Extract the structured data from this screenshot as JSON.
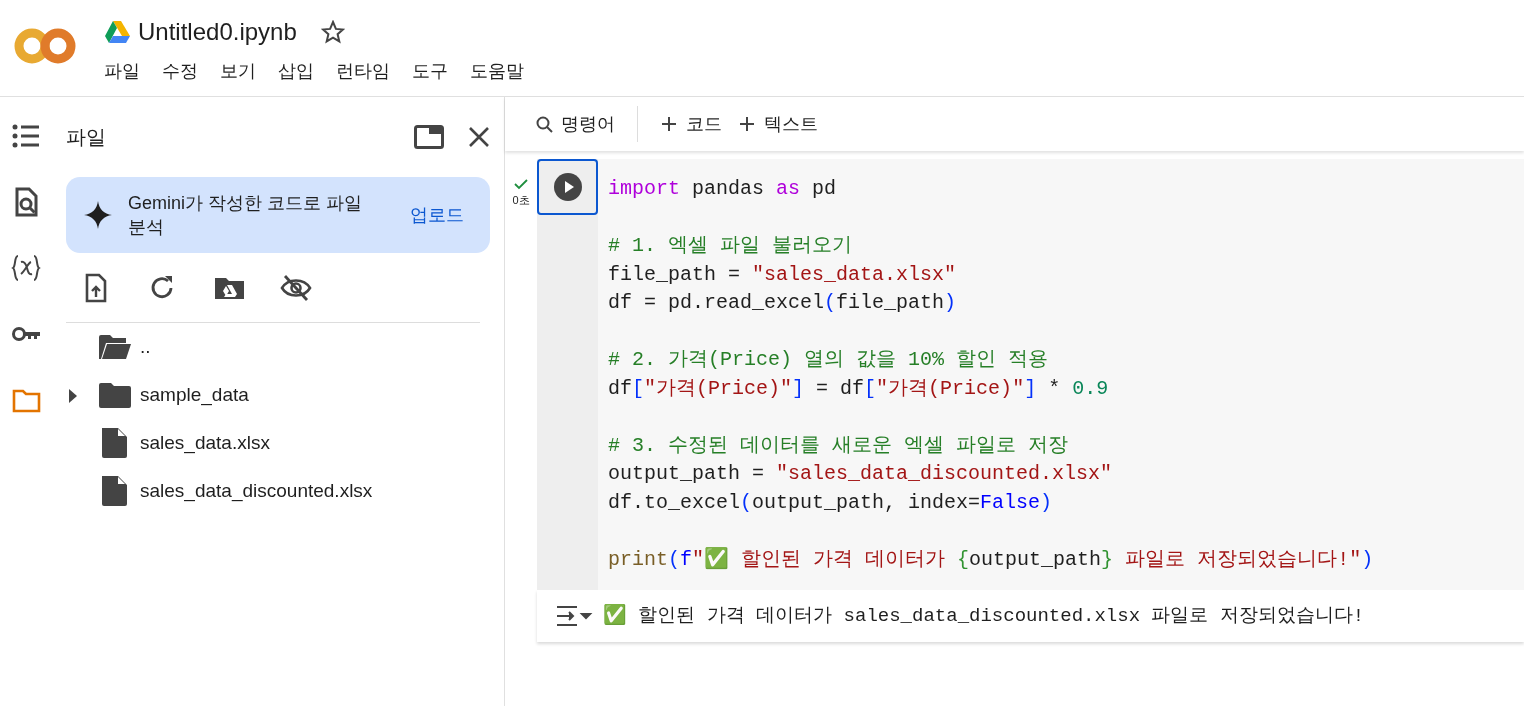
{
  "header": {
    "title": "Untitled0.ipynb",
    "starred": false,
    "menu": [
      "파일",
      "수정",
      "보기",
      "삽입",
      "런타임",
      "도구",
      "도움말"
    ]
  },
  "sidebar": {
    "rail": [
      {
        "kind": "toc",
        "selected": false
      },
      {
        "kind": "find",
        "selected": false
      },
      {
        "kind": "variables",
        "selected": false
      },
      {
        "kind": "secrets",
        "selected": false
      },
      {
        "kind": "files",
        "selected": true
      }
    ],
    "panel": {
      "title": "파일",
      "banner": {
        "text": "Gemini가 작성한 코드로 파일 분석",
        "action": "업로드"
      },
      "tools": [
        {
          "kind": "upload"
        },
        {
          "kind": "refresh"
        },
        {
          "kind": "drive"
        },
        {
          "kind": "hidden"
        }
      ],
      "tree": [
        {
          "kind": "parent",
          "name": ".."
        },
        {
          "kind": "folder",
          "name": "sample_data",
          "expanded": false
        },
        {
          "kind": "file",
          "name": "sales_data.xlsx"
        },
        {
          "kind": "file",
          "name": "sales_data_discounted.xlsx"
        }
      ]
    }
  },
  "toolbar": [
    {
      "kind": "search",
      "label": "명령어"
    },
    {
      "kind": "add",
      "label": "코드"
    },
    {
      "kind": "add",
      "label": "텍스트"
    }
  ],
  "cell": {
    "succeeded": true,
    "time": "0초",
    "code": [
      [
        [
          {
            "kind": "kw",
            "text": "import"
          },
          {
            "kind": "plain",
            "text": " pandas "
          },
          {
            "kind": "kw",
            "text": "as"
          },
          {
            "kind": "plain",
            "text": " pd"
          }
        ]
      ],
      [
        [
          {
            "kind": "comment",
            "text": "# 1. 엑셀 파일 불러오기"
          }
        ],
        [
          {
            "kind": "plain",
            "text": "file_path = "
          },
          {
            "kind": "str",
            "text": "\"sales_data.xlsx\""
          }
        ],
        [
          {
            "kind": "plain",
            "text": "df = pd.read_excel"
          },
          {
            "kind": "bracket",
            "text": "("
          },
          {
            "kind": "plain",
            "text": "file_path"
          },
          {
            "kind": "bracket",
            "text": ")"
          }
        ]
      ],
      [
        [
          {
            "kind": "comment",
            "text": "# 2. 가격(Price) 열의 값을 10% 할인 적용"
          }
        ],
        [
          {
            "kind": "plain",
            "text": "df"
          },
          {
            "kind": "bracket",
            "text": "["
          },
          {
            "kind": "str",
            "text": "\"가격(Price)\""
          },
          {
            "kind": "bracket",
            "text": "]"
          },
          {
            "kind": "plain",
            "text": " = df"
          },
          {
            "kind": "bracket",
            "text": "["
          },
          {
            "kind": "str",
            "text": "\"가격(Price)\""
          },
          {
            "kind": "bracket",
            "text": "]"
          },
          {
            "kind": "plain",
            "text": " * "
          },
          {
            "kind": "num",
            "text": "0.9"
          }
        ]
      ],
      [
        [
          {
            "kind": "comment",
            "text": "# 3. 수정된 데이터를 새로운 엑셀 파일로 저장"
          }
        ],
        [
          {
            "kind": "plain",
            "text": "output_path = "
          },
          {
            "kind": "str",
            "text": "\"sales_data_discounted.xlsx\""
          }
        ],
        [
          {
            "kind": "plain",
            "text": "df.to_excel"
          },
          {
            "kind": "bracket",
            "text": "("
          },
          {
            "kind": "plain",
            "text": "output_path, index="
          },
          {
            "kind": "const",
            "text": "False"
          },
          {
            "kind": "bracket",
            "text": ")"
          }
        ]
      ],
      [
        [
          {
            "kind": "builtin",
            "text": "print"
          },
          {
            "kind": "bracket",
            "text": "("
          },
          {
            "kind": "const",
            "text": "f"
          },
          {
            "kind": "str",
            "text": "\"✅ 할인된 가격 데이터가 "
          },
          {
            "kind": "brace",
            "text": "{"
          },
          {
            "kind": "plain",
            "text": "output_path"
          },
          {
            "kind": "brace",
            "text": "}"
          },
          {
            "kind": "str",
            "text": " 파일로 저장되었습니다!\""
          },
          {
            "kind": "bracket",
            "text": ")"
          }
        ]
      ]
    ],
    "output": "✅ 할인된 가격 데이터가 sales_data_discounted.xlsx 파일로 저장되었습니다!"
  }
}
